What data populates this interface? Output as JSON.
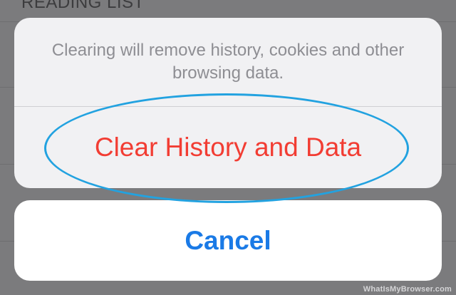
{
  "background": {
    "section_label": "READING LIST"
  },
  "action_sheet": {
    "message": "Clearing will remove history, cookies and other browsing data.",
    "destructive_label": "Clear History and Data",
    "cancel_label": "Cancel"
  },
  "watermark": {
    "text": "WhatIsMyBrowser.com"
  },
  "colors": {
    "destructive": "#f23d33",
    "cancel": "#1a7ae6",
    "highlight_ring": "#22a2e0"
  }
}
